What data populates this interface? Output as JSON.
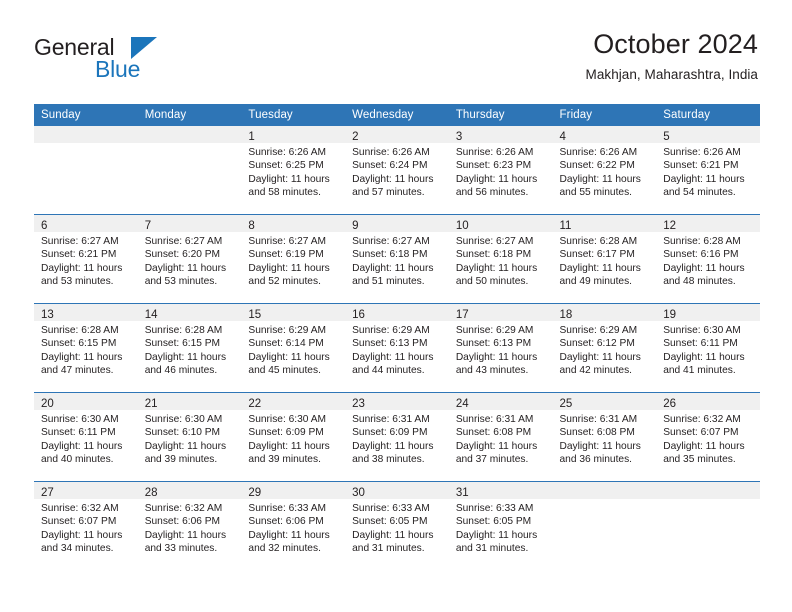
{
  "brand": {
    "name_top": "General",
    "name_bottom": "Blue",
    "accent_color": "#1b75bb"
  },
  "header": {
    "title": "October 2024",
    "location": "Makhjan, Maharashtra, India"
  },
  "calendar": {
    "header_color": "#2e75b6",
    "weekday_headers": [
      "Sunday",
      "Monday",
      "Tuesday",
      "Wednesday",
      "Thursday",
      "Friday",
      "Saturday"
    ],
    "weeks": [
      [
        {
          "day": "",
          "sunrise": "",
          "sunset": "",
          "daylight_line1": "",
          "daylight_line2": ""
        },
        {
          "day": "",
          "sunrise": "",
          "sunset": "",
          "daylight_line1": "",
          "daylight_line2": ""
        },
        {
          "day": "1",
          "sunrise": "Sunrise: 6:26 AM",
          "sunset": "Sunset: 6:25 PM",
          "daylight_line1": "Daylight: 11 hours",
          "daylight_line2": "and 58 minutes."
        },
        {
          "day": "2",
          "sunrise": "Sunrise: 6:26 AM",
          "sunset": "Sunset: 6:24 PM",
          "daylight_line1": "Daylight: 11 hours",
          "daylight_line2": "and 57 minutes."
        },
        {
          "day": "3",
          "sunrise": "Sunrise: 6:26 AM",
          "sunset": "Sunset: 6:23 PM",
          "daylight_line1": "Daylight: 11 hours",
          "daylight_line2": "and 56 minutes."
        },
        {
          "day": "4",
          "sunrise": "Sunrise: 6:26 AM",
          "sunset": "Sunset: 6:22 PM",
          "daylight_line1": "Daylight: 11 hours",
          "daylight_line2": "and 55 minutes."
        },
        {
          "day": "5",
          "sunrise": "Sunrise: 6:26 AM",
          "sunset": "Sunset: 6:21 PM",
          "daylight_line1": "Daylight: 11 hours",
          "daylight_line2": "and 54 minutes."
        }
      ],
      [
        {
          "day": "6",
          "sunrise": "Sunrise: 6:27 AM",
          "sunset": "Sunset: 6:21 PM",
          "daylight_line1": "Daylight: 11 hours",
          "daylight_line2": "and 53 minutes."
        },
        {
          "day": "7",
          "sunrise": "Sunrise: 6:27 AM",
          "sunset": "Sunset: 6:20 PM",
          "daylight_line1": "Daylight: 11 hours",
          "daylight_line2": "and 53 minutes."
        },
        {
          "day": "8",
          "sunrise": "Sunrise: 6:27 AM",
          "sunset": "Sunset: 6:19 PM",
          "daylight_line1": "Daylight: 11 hours",
          "daylight_line2": "and 52 minutes."
        },
        {
          "day": "9",
          "sunrise": "Sunrise: 6:27 AM",
          "sunset": "Sunset: 6:18 PM",
          "daylight_line1": "Daylight: 11 hours",
          "daylight_line2": "and 51 minutes."
        },
        {
          "day": "10",
          "sunrise": "Sunrise: 6:27 AM",
          "sunset": "Sunset: 6:18 PM",
          "daylight_line1": "Daylight: 11 hours",
          "daylight_line2": "and 50 minutes."
        },
        {
          "day": "11",
          "sunrise": "Sunrise: 6:28 AM",
          "sunset": "Sunset: 6:17 PM",
          "daylight_line1": "Daylight: 11 hours",
          "daylight_line2": "and 49 minutes."
        },
        {
          "day": "12",
          "sunrise": "Sunrise: 6:28 AM",
          "sunset": "Sunset: 6:16 PM",
          "daylight_line1": "Daylight: 11 hours",
          "daylight_line2": "and 48 minutes."
        }
      ],
      [
        {
          "day": "13",
          "sunrise": "Sunrise: 6:28 AM",
          "sunset": "Sunset: 6:15 PM",
          "daylight_line1": "Daylight: 11 hours",
          "daylight_line2": "and 47 minutes."
        },
        {
          "day": "14",
          "sunrise": "Sunrise: 6:28 AM",
          "sunset": "Sunset: 6:15 PM",
          "daylight_line1": "Daylight: 11 hours",
          "daylight_line2": "and 46 minutes."
        },
        {
          "day": "15",
          "sunrise": "Sunrise: 6:29 AM",
          "sunset": "Sunset: 6:14 PM",
          "daylight_line1": "Daylight: 11 hours",
          "daylight_line2": "and 45 minutes."
        },
        {
          "day": "16",
          "sunrise": "Sunrise: 6:29 AM",
          "sunset": "Sunset: 6:13 PM",
          "daylight_line1": "Daylight: 11 hours",
          "daylight_line2": "and 44 minutes."
        },
        {
          "day": "17",
          "sunrise": "Sunrise: 6:29 AM",
          "sunset": "Sunset: 6:13 PM",
          "daylight_line1": "Daylight: 11 hours",
          "daylight_line2": "and 43 minutes."
        },
        {
          "day": "18",
          "sunrise": "Sunrise: 6:29 AM",
          "sunset": "Sunset: 6:12 PM",
          "daylight_line1": "Daylight: 11 hours",
          "daylight_line2": "and 42 minutes."
        },
        {
          "day": "19",
          "sunrise": "Sunrise: 6:30 AM",
          "sunset": "Sunset: 6:11 PM",
          "daylight_line1": "Daylight: 11 hours",
          "daylight_line2": "and 41 minutes."
        }
      ],
      [
        {
          "day": "20",
          "sunrise": "Sunrise: 6:30 AM",
          "sunset": "Sunset: 6:11 PM",
          "daylight_line1": "Daylight: 11 hours",
          "daylight_line2": "and 40 minutes."
        },
        {
          "day": "21",
          "sunrise": "Sunrise: 6:30 AM",
          "sunset": "Sunset: 6:10 PM",
          "daylight_line1": "Daylight: 11 hours",
          "daylight_line2": "and 39 minutes."
        },
        {
          "day": "22",
          "sunrise": "Sunrise: 6:30 AM",
          "sunset": "Sunset: 6:09 PM",
          "daylight_line1": "Daylight: 11 hours",
          "daylight_line2": "and 39 minutes."
        },
        {
          "day": "23",
          "sunrise": "Sunrise: 6:31 AM",
          "sunset": "Sunset: 6:09 PM",
          "daylight_line1": "Daylight: 11 hours",
          "daylight_line2": "and 38 minutes."
        },
        {
          "day": "24",
          "sunrise": "Sunrise: 6:31 AM",
          "sunset": "Sunset: 6:08 PM",
          "daylight_line1": "Daylight: 11 hours",
          "daylight_line2": "and 37 minutes."
        },
        {
          "day": "25",
          "sunrise": "Sunrise: 6:31 AM",
          "sunset": "Sunset: 6:08 PM",
          "daylight_line1": "Daylight: 11 hours",
          "daylight_line2": "and 36 minutes."
        },
        {
          "day": "26",
          "sunrise": "Sunrise: 6:32 AM",
          "sunset": "Sunset: 6:07 PM",
          "daylight_line1": "Daylight: 11 hours",
          "daylight_line2": "and 35 minutes."
        }
      ],
      [
        {
          "day": "27",
          "sunrise": "Sunrise: 6:32 AM",
          "sunset": "Sunset: 6:07 PM",
          "daylight_line1": "Daylight: 11 hours",
          "daylight_line2": "and 34 minutes."
        },
        {
          "day": "28",
          "sunrise": "Sunrise: 6:32 AM",
          "sunset": "Sunset: 6:06 PM",
          "daylight_line1": "Daylight: 11 hours",
          "daylight_line2": "and 33 minutes."
        },
        {
          "day": "29",
          "sunrise": "Sunrise: 6:33 AM",
          "sunset": "Sunset: 6:06 PM",
          "daylight_line1": "Daylight: 11 hours",
          "daylight_line2": "and 32 minutes."
        },
        {
          "day": "30",
          "sunrise": "Sunrise: 6:33 AM",
          "sunset": "Sunset: 6:05 PM",
          "daylight_line1": "Daylight: 11 hours",
          "daylight_line2": "and 31 minutes."
        },
        {
          "day": "31",
          "sunrise": "Sunrise: 6:33 AM",
          "sunset": "Sunset: 6:05 PM",
          "daylight_line1": "Daylight: 11 hours",
          "daylight_line2": "and 31 minutes."
        },
        {
          "day": "",
          "sunrise": "",
          "sunset": "",
          "daylight_line1": "",
          "daylight_line2": ""
        },
        {
          "day": "",
          "sunrise": "",
          "sunset": "",
          "daylight_line1": "",
          "daylight_line2": ""
        }
      ]
    ]
  }
}
